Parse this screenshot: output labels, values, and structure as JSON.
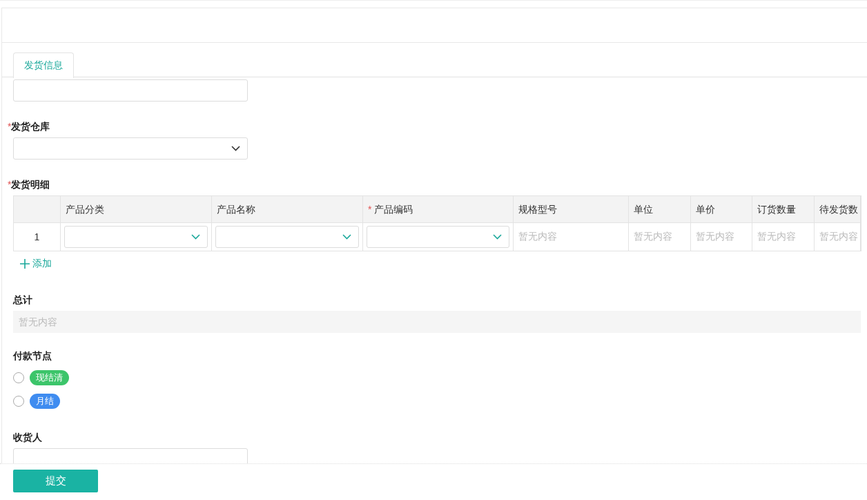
{
  "tabs": [
    {
      "label": "发货信息",
      "selected": true
    }
  ],
  "fields": [
    {
      "kind": "text"
    },
    {
      "kind": "select",
      "label": "发货仓库",
      "required_mark": "*"
    },
    {
      "kind": "table",
      "label": "发货明细",
      "required_mark": "*",
      "table": {
        "columns": [
          {
            "label": "产品分类"
          },
          {
            "label": "产品名称"
          },
          {
            "label": "产品编码",
            "required_mark": "*"
          },
          {
            "label": "规格型号"
          },
          {
            "label": "单位"
          },
          {
            "label": "单价"
          },
          {
            "label": "订货数量"
          },
          {
            "label": "待发货数"
          }
        ],
        "rows": [
          {
            "index": "1",
            "cells": [
              {
                "kind": "select"
              },
              {
                "kind": "select"
              },
              {
                "kind": "select"
              },
              {
                "kind": "text",
                "placeholder": "暂无内容"
              },
              {
                "kind": "text",
                "placeholder": "暂无内容"
              },
              {
                "kind": "text",
                "placeholder": "暂无内容"
              },
              {
                "kind": "text",
                "placeholder": "暂无内容"
              },
              {
                "kind": "text",
                "placeholder": "暂无内容"
              }
            ]
          }
        ],
        "add_link": "添加"
      }
    },
    {
      "kind": "readonly",
      "label": "总计",
      "placeholder": "暂无内容"
    },
    {
      "kind": "radio",
      "label": "付款节点",
      "options": [
        {
          "label": "现结清",
          "selected": false,
          "color": "#3cc56a"
        },
        {
          "label": "月结",
          "selected": false,
          "color": "#3f8cf0"
        }
      ]
    },
    {
      "kind": "text",
      "label": "收货人"
    }
  ],
  "footer": {
    "submit": "提交"
  }
}
